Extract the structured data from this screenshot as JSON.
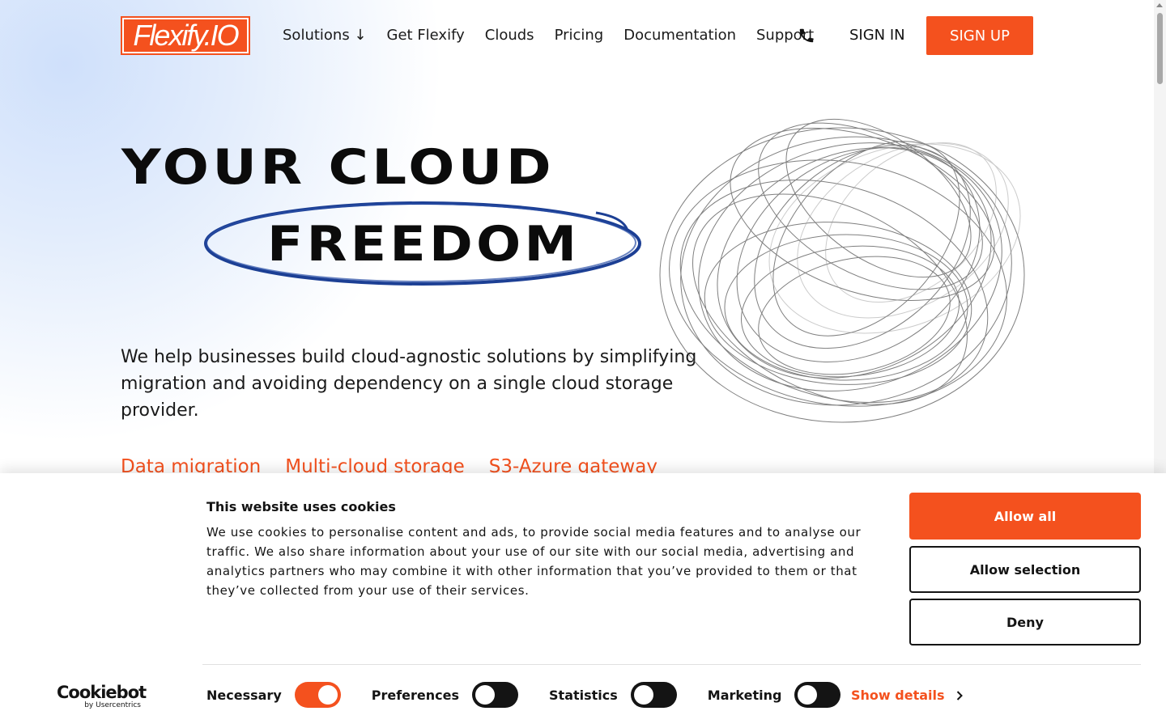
{
  "brand": {
    "logo_text": "Flexify.IO",
    "accent_color": "#f4511e"
  },
  "nav": {
    "items": [
      "Solutions ↓",
      "Get Flexify",
      "Clouds",
      "Pricing",
      "Documentation",
      "Support"
    ],
    "sign_in": "SIGN IN",
    "sign_up": "SIGN UP"
  },
  "hero": {
    "line1": "YOUR CLOUD",
    "line2": "FREEDOM",
    "description": "We help businesses build cloud-agnostic solutions by simplifying migration and avoiding dependency on a single cloud storage provider.",
    "links": [
      "Data migration",
      "Multi-cloud storage",
      "S3-Azure gateway"
    ]
  },
  "cookie": {
    "title": "This website uses cookies",
    "text": "We use cookies to personalise content and ads, to provide social media features and to analyse our traffic. We also share information about your use of our site with our social media, advertising and analytics partners who may combine it with other information that you’ve provided to them or that they’ve collected from your use of their services.",
    "allow_all": "Allow all",
    "allow_selection": "Allow selection",
    "deny": "Deny",
    "logo_main": "Cookiebot",
    "logo_sub": "by Usercentrics",
    "toggles": [
      {
        "label": "Necessary",
        "on": true
      },
      {
        "label": "Preferences",
        "on": false
      },
      {
        "label": "Statistics",
        "on": false
      },
      {
        "label": "Marketing",
        "on": false
      }
    ],
    "show_details": "Show details"
  }
}
